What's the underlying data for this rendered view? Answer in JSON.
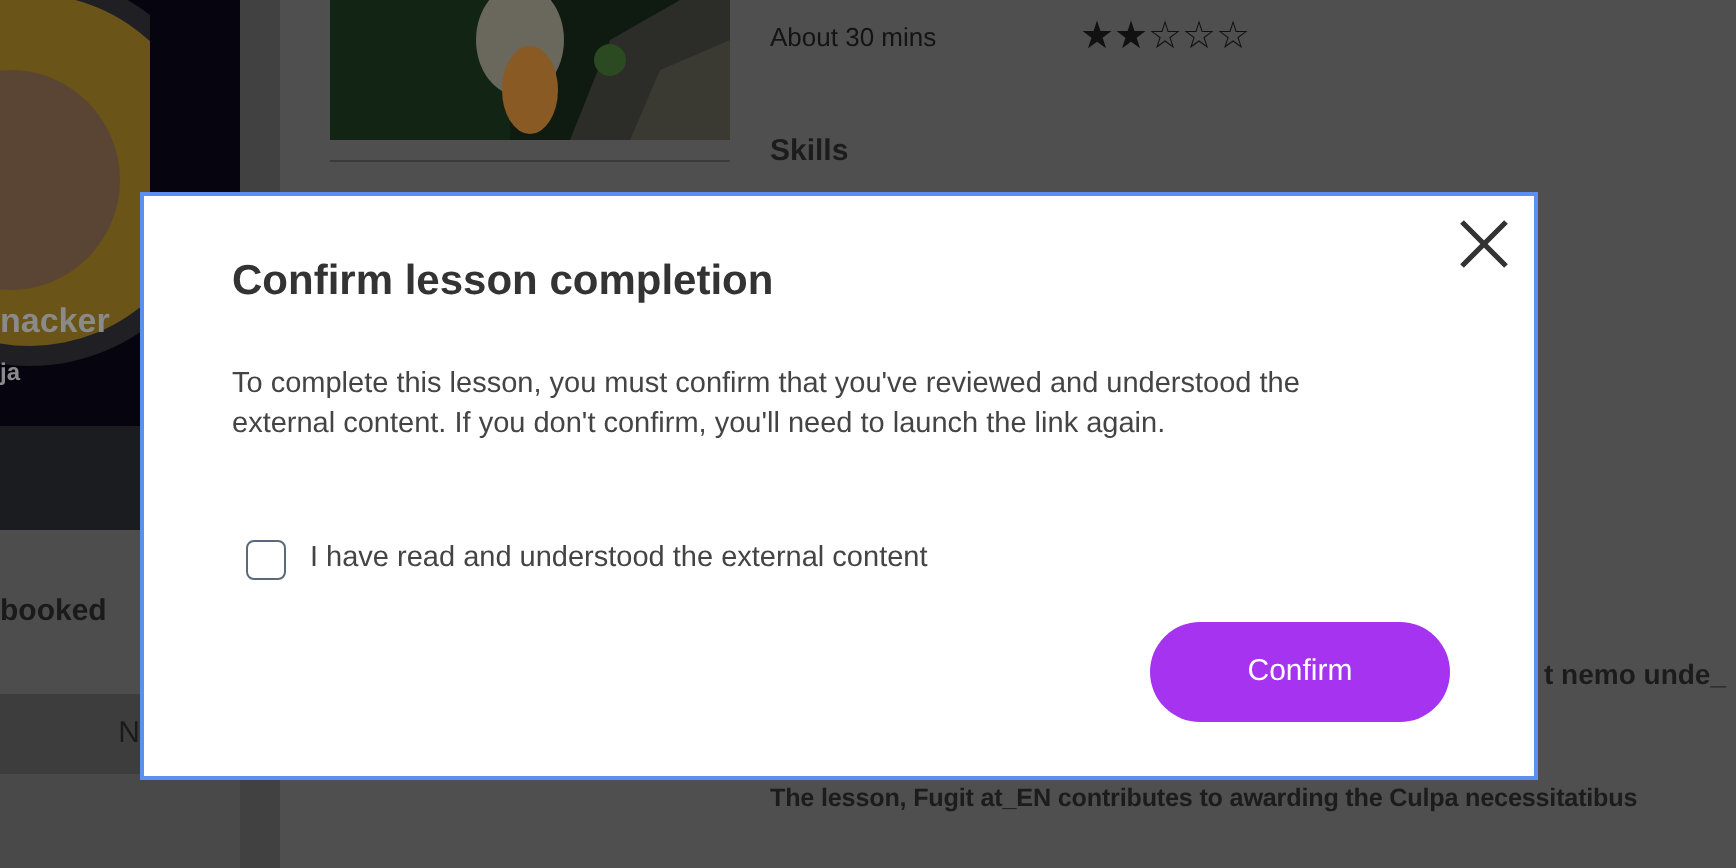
{
  "sidebar": {
    "profile_name": "nacker",
    "profile_subtitle": "ja",
    "booked_label": "booked",
    "row_label": "N"
  },
  "lesson": {
    "duration": "About 30 mins",
    "rating": {
      "stars": 2
    },
    "skills_heading": "Skills",
    "text_1": "t nemo unde_",
    "text_2": "The lesson, Fugit at_EN contributes to awarding the Culpa necessitatibus"
  },
  "dialog": {
    "title": "Confirm lesson completion",
    "message": "To complete this lesson, you must confirm that you've reviewed and understood the external content. If you don't confirm, you'll need to launch the link again.",
    "checkbox": {
      "label": "I have read and understood the external content",
      "checked": false
    },
    "confirm_button": "Confirm"
  }
}
